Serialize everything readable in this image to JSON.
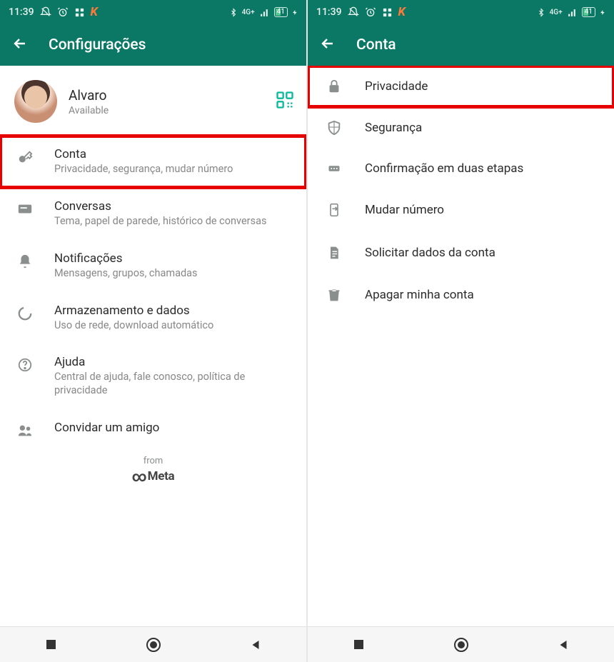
{
  "status": {
    "time": "11:39",
    "battery": "41",
    "net": "4G+"
  },
  "left": {
    "title": "Configurações",
    "profile_name": "Alvaro",
    "profile_status": "Available",
    "rows": [
      {
        "title": "Conta",
        "sub": "Privacidade, segurança, mudar número"
      },
      {
        "title": "Conversas",
        "sub": "Tema, papel de parede, histórico de conversas"
      },
      {
        "title": "Notificações",
        "sub": "Mensagens, grupos, chamadas"
      },
      {
        "title": "Armazenamento e dados",
        "sub": "Uso de rede, download automático"
      },
      {
        "title": "Ajuda",
        "sub": "Central de ajuda, fale conosco, política de privacidade"
      },
      {
        "title": "Convidar um amigo",
        "sub": ""
      }
    ],
    "from": "from",
    "brand": "Meta"
  },
  "right": {
    "title": "Conta",
    "rows": [
      {
        "title": "Privacidade"
      },
      {
        "title": "Segurança"
      },
      {
        "title": "Confirmação em duas etapas"
      },
      {
        "title": "Mudar número"
      },
      {
        "title": "Solicitar dados da conta"
      },
      {
        "title": "Apagar minha conta"
      }
    ]
  }
}
